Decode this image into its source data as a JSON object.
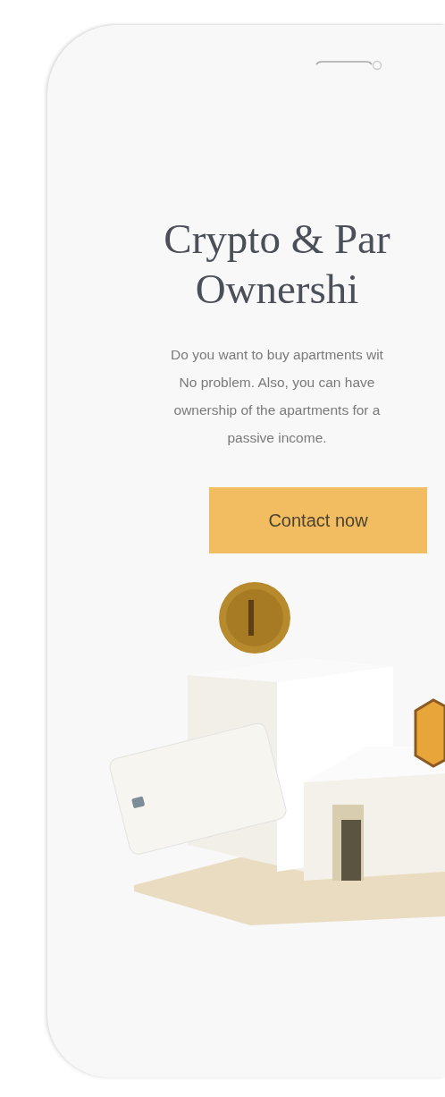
{
  "hero": {
    "title_lines": [
      "Crypto & Par",
      "Ownershi"
    ],
    "description_lines": [
      "Do you want to buy apartments wit",
      "No problem. Also, you can have",
      "ownership of the apartments for a",
      "passive income."
    ],
    "button": "Contact now"
  }
}
